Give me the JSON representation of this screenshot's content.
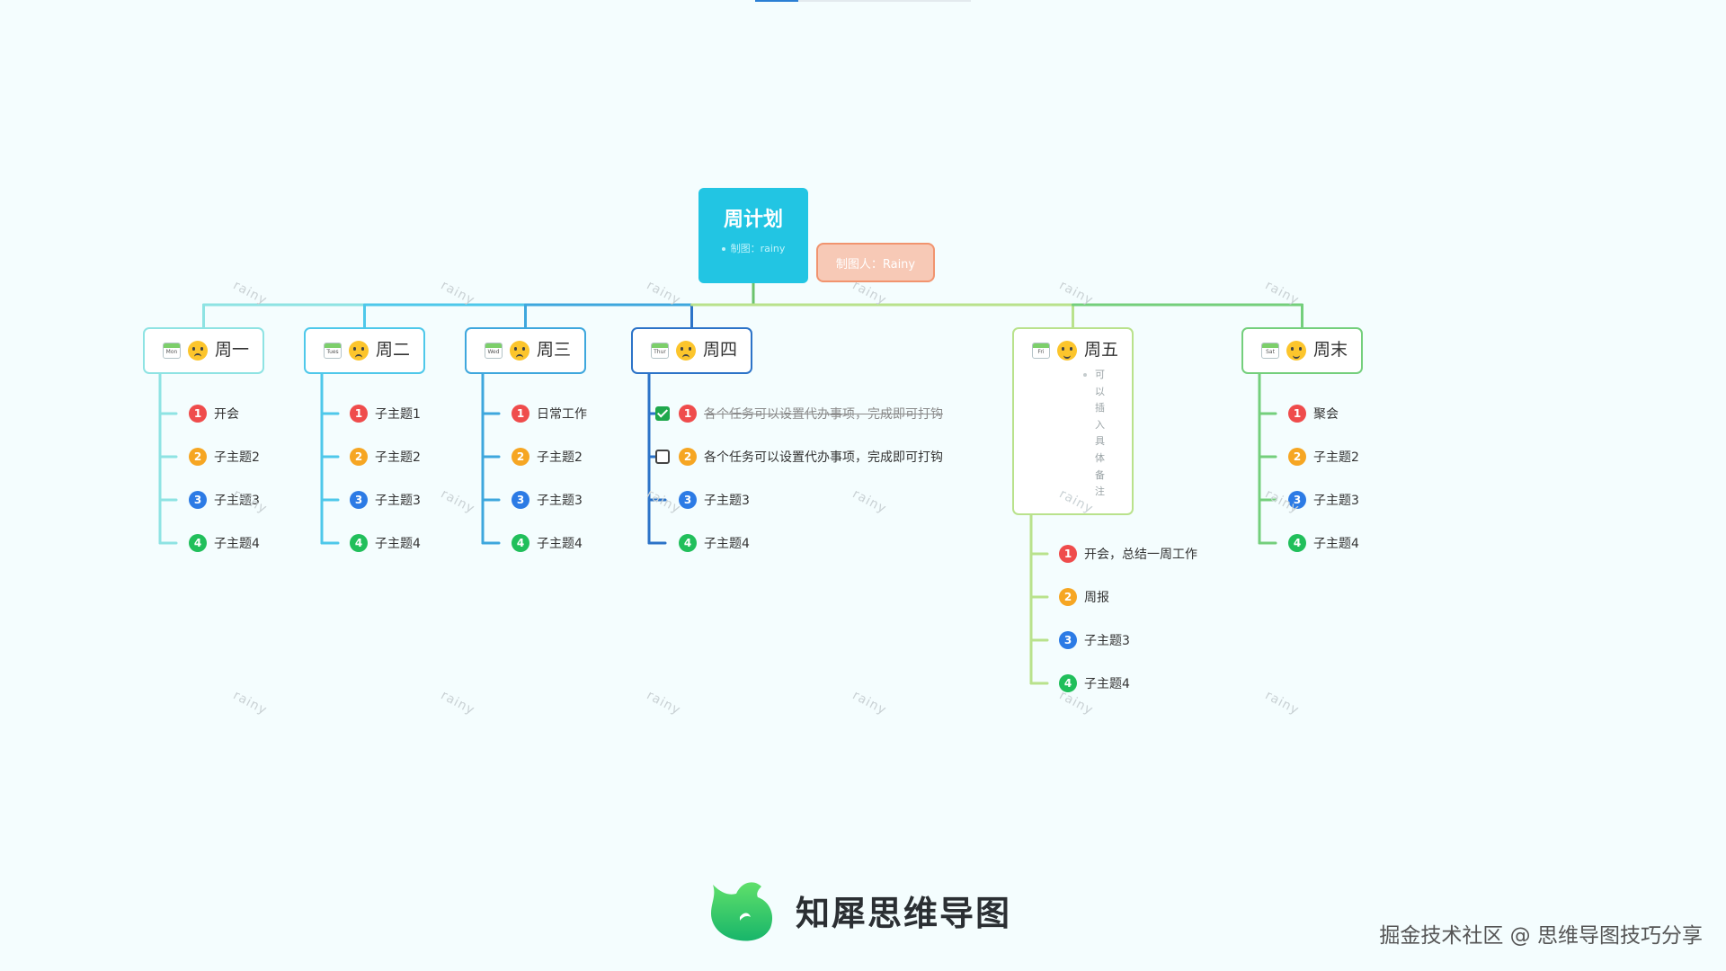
{
  "root": {
    "title": "周计划",
    "note": "制图：rainy"
  },
  "maker": "制图人：Rainy",
  "watermark": "rainy",
  "days": [
    {
      "label": "周一",
      "cal": "Mon",
      "items": [
        {
          "n": "1",
          "text": "开会"
        },
        {
          "n": "2",
          "text": "子主题2"
        },
        {
          "n": "3",
          "text": "子主题3"
        },
        {
          "n": "4",
          "text": "子主题4"
        }
      ]
    },
    {
      "label": "周二",
      "cal": "Tues",
      "items": [
        {
          "n": "1",
          "text": "子主题1"
        },
        {
          "n": "2",
          "text": "子主题2"
        },
        {
          "n": "3",
          "text": "子主题3"
        },
        {
          "n": "4",
          "text": "子主题4"
        }
      ]
    },
    {
      "label": "周三",
      "cal": "Wed",
      "items": [
        {
          "n": "1",
          "text": "日常工作"
        },
        {
          "n": "2",
          "text": "子主题2"
        },
        {
          "n": "3",
          "text": "子主题3"
        },
        {
          "n": "4",
          "text": "子主题4"
        }
      ]
    },
    {
      "label": "周四",
      "cal": "Thur",
      "items": [
        {
          "n": "1",
          "text": "各个任务可以设置代办事项，完成即可打钩",
          "todo": "done"
        },
        {
          "n": "2",
          "text": "各个任务可以设置代办事项，完成即可打钩",
          "todo": "open"
        },
        {
          "n": "3",
          "text": "子主题3"
        },
        {
          "n": "4",
          "text": "子主题4"
        }
      ]
    },
    {
      "label": "周五",
      "cal": "Fri",
      "note": "可以插入具体备注",
      "items": [
        {
          "n": "1",
          "text": "开会，总结一周工作"
        },
        {
          "n": "2",
          "text": "周报"
        },
        {
          "n": "3",
          "text": "子主题3"
        },
        {
          "n": "4",
          "text": "子主题4"
        }
      ]
    },
    {
      "label": "周末",
      "cal": "Sat",
      "items": [
        {
          "n": "1",
          "text": "聚会"
        },
        {
          "n": "2",
          "text": "子主题2"
        },
        {
          "n": "3",
          "text": "子主题3"
        },
        {
          "n": "4",
          "text": "子主题4"
        }
      ]
    }
  ],
  "brand": "知犀思维导图",
  "credit": "掘金技术社区 @ 思维导图技巧分享",
  "colors": {
    "root": "#22c5e3",
    "maker_bg": "#f7c9b6",
    "maker_border": "#f1946f",
    "branches": [
      "#8ee3e3",
      "#4ec8ea",
      "#3ea7dd",
      "#2c73c8",
      "#b9e28c",
      "#74cf7c"
    ]
  }
}
